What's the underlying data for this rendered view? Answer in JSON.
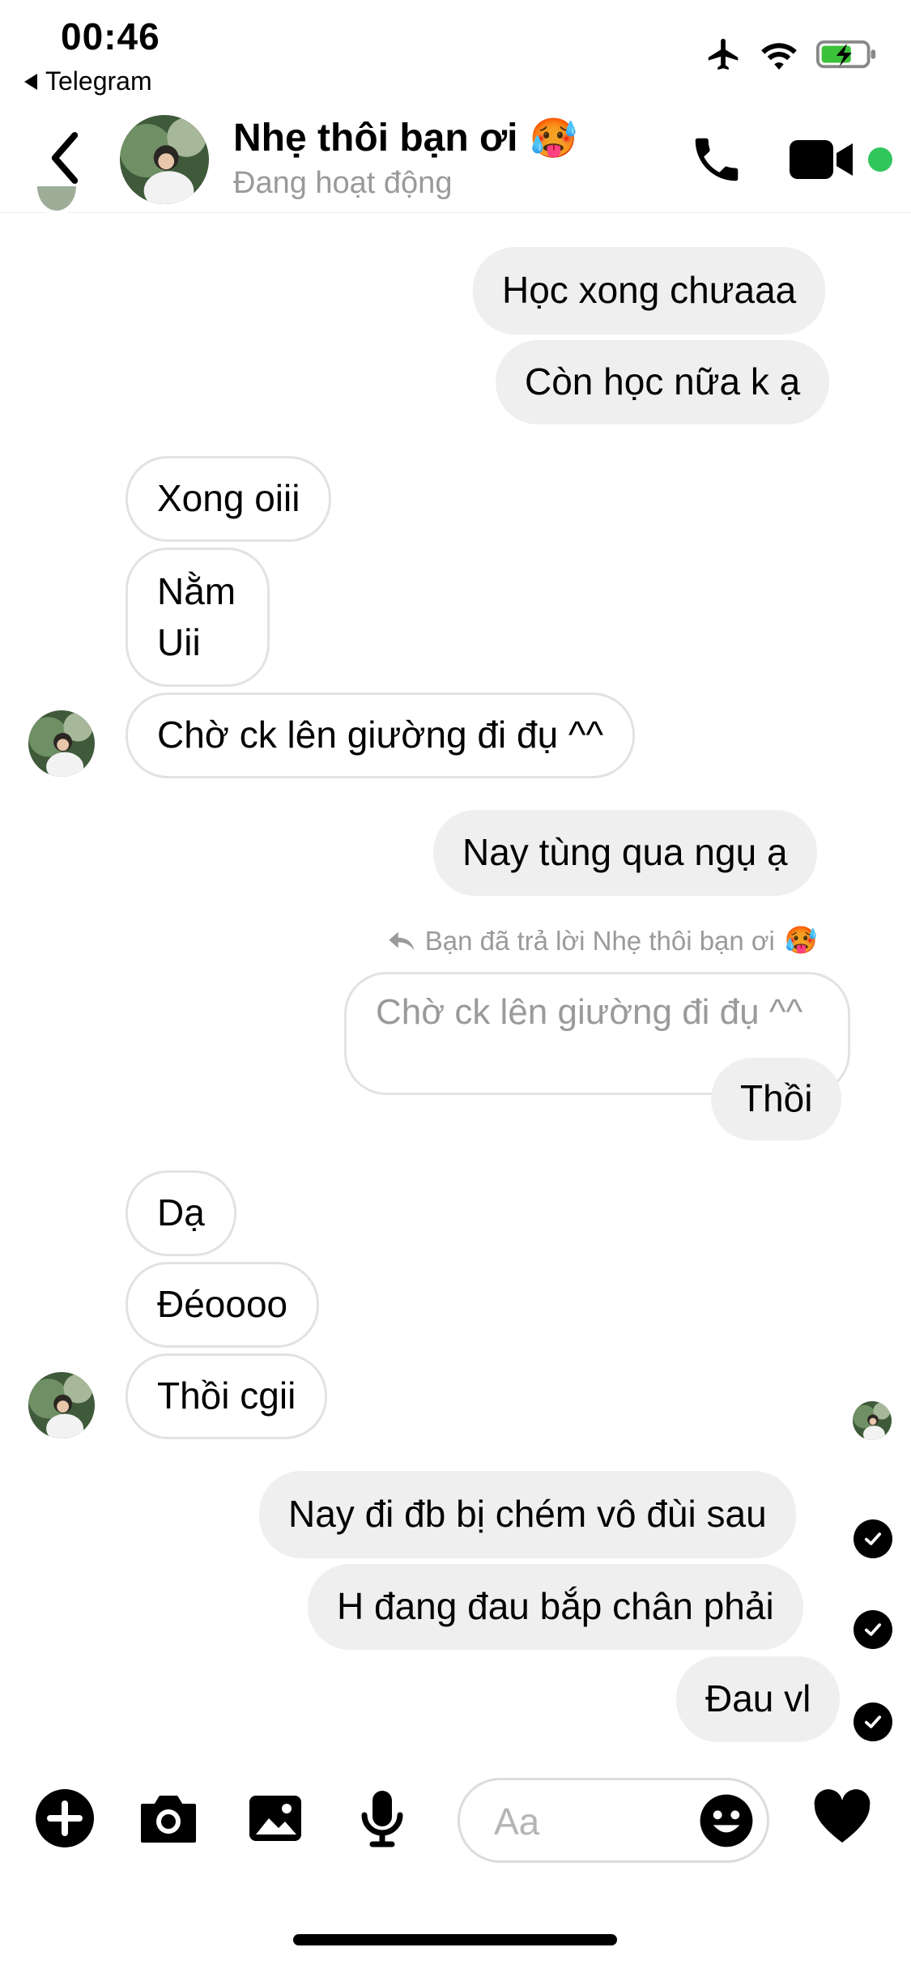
{
  "status_bar": {
    "time": "00:46",
    "back_app": "Telegram"
  },
  "header": {
    "name": "Nhẹ thôi bạn ơi",
    "name_emoji": "🥵",
    "status": "Đang hoạt động"
  },
  "messages": {
    "m1": "Học xong chưaaa",
    "m2": "Còn học nữa k ạ",
    "m3": "Xong oiii",
    "m4": "Nằm\nUii",
    "m5": "Chờ ck lên giường đi đụ ^^",
    "m6": "Nay tùng qua ngụ ạ",
    "reply_note": "Bạn đã trả lời Nhẹ thôi bạn ơi",
    "reply_emoji": "🥵",
    "quoted": "Chờ ck lên giường đi đụ ^^",
    "m7": "Thồi",
    "m8": "Dạ",
    "m9": "Đéoooo",
    "m10": "Thồi cgii",
    "m11": "Nay đi đb bị chém vô đùi sau",
    "m12": "H đang đau bắp chân phải",
    "m13": "Đau vl"
  },
  "composer": {
    "placeholder": "Aa"
  },
  "colors": {
    "online": "#31c65c",
    "my_bubble": "#efefef",
    "their_border": "#e2e2e2"
  },
  "icons": [
    "back-chevron-icon",
    "phone-icon",
    "video-camera-icon",
    "plus-icon",
    "camera-icon",
    "image-icon",
    "microphone-icon",
    "emoji-icon",
    "heart-icon",
    "checkmark-icon",
    "airplane-icon",
    "wifi-icon",
    "battery-icon"
  ]
}
